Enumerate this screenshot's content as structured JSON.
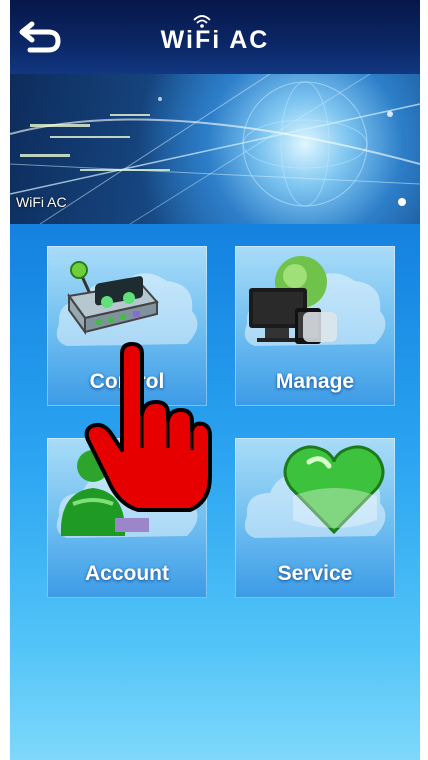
{
  "header": {
    "title": "WiFi AC",
    "back_icon": "back-arrow-icon"
  },
  "banner": {
    "label": "WiFi AC",
    "carousel_pages": 1,
    "active_page": 1
  },
  "tiles": [
    {
      "id": "control",
      "label": "Control",
      "icon": "control-panel-icon"
    },
    {
      "id": "manage",
      "label": "Manage",
      "icon": "devices-icon"
    },
    {
      "id": "account",
      "label": "Account",
      "icon": "user-icon"
    },
    {
      "id": "service",
      "label": "Service",
      "icon": "heart-icon"
    }
  ],
  "overlay": {
    "icon": "tap-hand-pointer-icon"
  },
  "colors": {
    "header_bg": "#0b2766",
    "background_top": "#0a62c4",
    "background_bottom": "#7fd8fb",
    "tile_bg": "#6dbdf0",
    "pointer_red": "#e60000"
  }
}
